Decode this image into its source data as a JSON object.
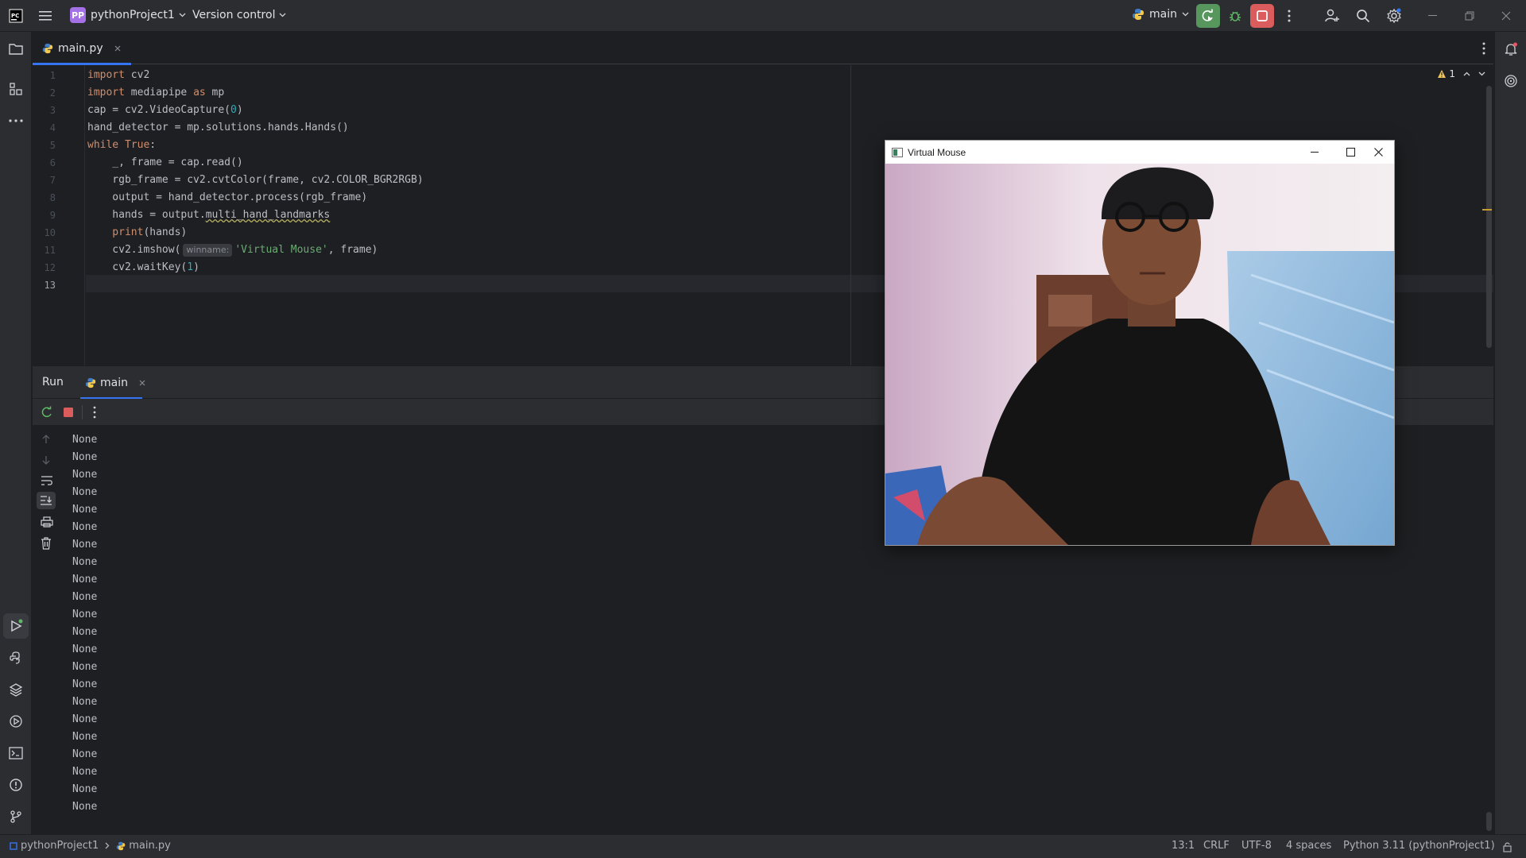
{
  "titlebar": {
    "project_badge": "PP",
    "project_name": "pythonProject1",
    "vcs_label": "Version control",
    "run_config": "main"
  },
  "editor": {
    "tab_label": "main.py",
    "warning_count": "1",
    "line_numbers": [
      "1",
      "2",
      "3",
      "4",
      "5",
      "6",
      "7",
      "8",
      "9",
      "10",
      "11",
      "12",
      "13"
    ],
    "code": {
      "l1_kw": "import",
      "l1_rest": " cv2",
      "l2_kw": "import",
      "l2_mid": " mediapipe ",
      "l2_as": "as",
      "l2_rest": " mp",
      "l3_a": "cap = cv2.VideoCapture(",
      "l3_num": "0",
      "l3_b": ")",
      "l4": "hand_detector = mp.solutions.hands.Hands()",
      "l5_kw": "while",
      "l5_true": " True",
      "l5_rest": ":",
      "l6": "    _, frame = cap.read()",
      "l7": "    rgb_frame = cv2.cvtColor(frame, cv2.COLOR_BGR2RGB)",
      "l8": "    output = hand_detector.process(rgb_frame)",
      "l9_a": "    hands = output.",
      "l9_b": "multi_hand_landmarks",
      "l10_fn": "    print",
      "l10_rest": "(hands)",
      "l11_a": "    cv2.imshow(",
      "l11_hint": "winname:",
      "l11_str": "'Virtual Mouse'",
      "l11_b": ", frame)",
      "l12_a": "    cv2.waitKey(",
      "l12_num": "1",
      "l12_b": ")"
    }
  },
  "run_panel": {
    "run_label": "Run",
    "tab_label": "main",
    "output_lines": [
      "None",
      "None",
      "None",
      "None",
      "None",
      "None",
      "None",
      "None",
      "None",
      "None",
      "None",
      "None",
      "None",
      "None",
      "None",
      "None",
      "None",
      "None",
      "None",
      "None",
      "None",
      "None"
    ]
  },
  "status": {
    "project": "pythonProject1",
    "file": "main.py",
    "position": "13:1",
    "line_sep": "CRLF",
    "encoding": "UTF-8",
    "indent": "4 spaces",
    "interpreter": "Python 3.11 (pythonProject1)"
  },
  "window": {
    "title": "Virtual Mouse"
  },
  "colors": {
    "accent": "#3574f0",
    "run_green": "#57965c",
    "stop_red": "#db5c5c"
  }
}
